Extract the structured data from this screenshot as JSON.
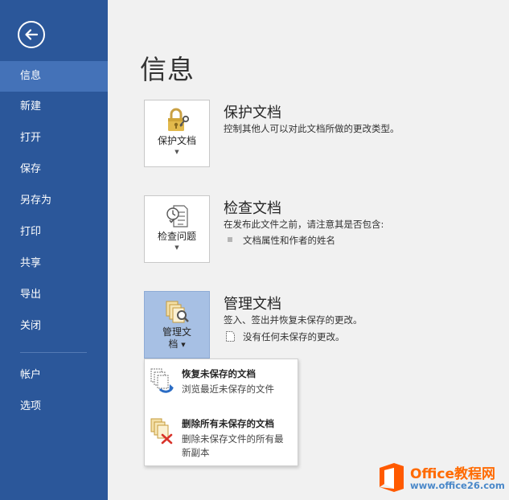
{
  "sidebar": {
    "back_icon": "back-arrow-circle-icon",
    "items": [
      {
        "label": "信息",
        "active": true
      },
      {
        "label": "新建"
      },
      {
        "label": "打开"
      },
      {
        "label": "保存"
      },
      {
        "label": "另存为"
      },
      {
        "label": "打印"
      },
      {
        "label": "共享"
      },
      {
        "label": "导出"
      },
      {
        "label": "关闭"
      },
      {
        "label": "帐户"
      },
      {
        "label": "选项"
      }
    ],
    "color": "#2b579a",
    "active_color": "#4472b8"
  },
  "main": {
    "title": "信息",
    "protect": {
      "button_label": "保护文档",
      "icon": "lock-key-icon",
      "title": "保护文档",
      "description": "控制其他人可以对此文档所做的更改类型。"
    },
    "inspect": {
      "button_label": "检查问题",
      "icon": "checklist-icon",
      "title": "检查文档",
      "description": "在发布此文件之前，请注意其是否包含:",
      "bullets": [
        "文档属性和作者的姓名"
      ]
    },
    "manage": {
      "button_label_line1": "管理文",
      "button_label_line2": "档",
      "icon": "document-search-icon",
      "title": "管理文档",
      "description": "签入、签出并恢复未保存的更改。",
      "status": "没有任何未保存的更改。",
      "status_icon": "document-icon"
    }
  },
  "dropdown": {
    "items": [
      {
        "title": "恢复未保存的文档",
        "description": "浏览最近未保存的文件",
        "icon": "recover-documents-icon"
      },
      {
        "title": "删除所有未保存的文档",
        "description": "删除未保存文件的所有最新副本",
        "icon": "delete-documents-icon"
      }
    ]
  },
  "watermark": {
    "name": "Office教程网",
    "url": "www.office26.com"
  }
}
